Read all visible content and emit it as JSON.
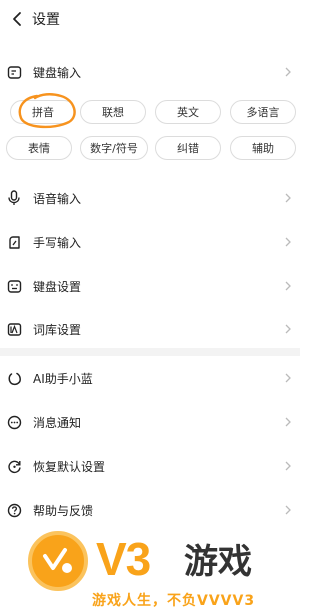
{
  "header": {
    "title": "设置"
  },
  "keyboard_input": {
    "label": "键盘输入"
  },
  "chips": [
    {
      "label": "拼音"
    },
    {
      "label": "联想"
    },
    {
      "label": "英文"
    },
    {
      "label": "多语言"
    },
    {
      "label": "表情"
    },
    {
      "label": "数字/符号"
    },
    {
      "label": "纠错"
    },
    {
      "label": "辅助"
    }
  ],
  "menu": [
    {
      "label": "语音输入",
      "icon": "microphone-icon"
    },
    {
      "label": "手写输入",
      "icon": "handwriting-icon"
    },
    {
      "label": "键盘设置",
      "icon": "keyboard-icon"
    },
    {
      "label": "词库设置",
      "icon": "dictionary-icon"
    },
    {
      "label": "AI助手小蓝",
      "icon": "ai-assistant-icon"
    },
    {
      "label": "消息通知",
      "icon": "message-icon"
    },
    {
      "label": "恢复默认设置",
      "icon": "restore-icon"
    },
    {
      "label": "帮助与反馈",
      "icon": "help-icon"
    }
  ],
  "watermark": {
    "brand": "V3",
    "brand_suffix": "游戏",
    "slogan": "游戏人生，不负VVVV3",
    "colors": {
      "orange": "#f9a31a",
      "dark": "#333333"
    }
  },
  "annotation": {
    "color": "#f7931e",
    "shape": "hand-drawn-circle"
  }
}
